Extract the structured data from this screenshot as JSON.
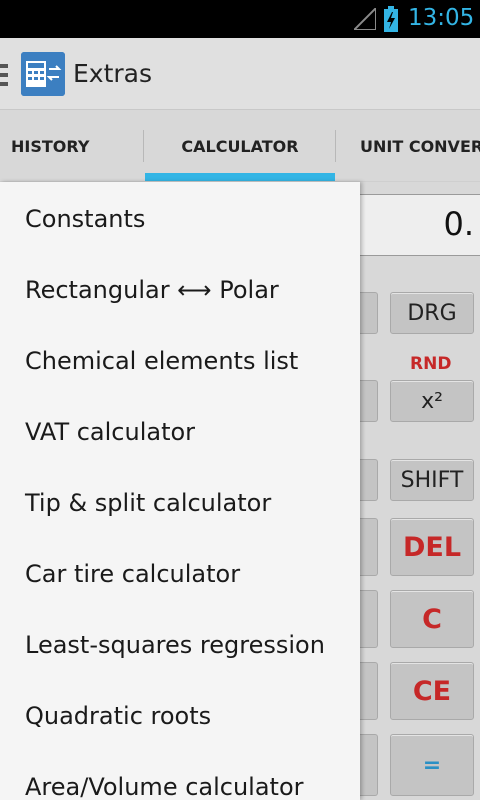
{
  "status_bar": {
    "time": "13:05",
    "icons": [
      "signal-icon",
      "battery-charging-icon"
    ],
    "accent_color": "#33b5e5"
  },
  "action_bar": {
    "title": "Extras",
    "icon": "calculator-convert-icon"
  },
  "tabs": [
    {
      "label": "HISTORY"
    },
    {
      "label": "CALCULATOR",
      "selected": true
    },
    {
      "label": "UNIT CONVERT"
    }
  ],
  "drawer": {
    "items": [
      {
        "label": "Constants"
      },
      {
        "label": "Rectangular ⟷ Polar"
      },
      {
        "label": "Chemical elements list"
      },
      {
        "label": "VAT calculator"
      },
      {
        "label": "Tip & split calculator"
      },
      {
        "label": "Car tire calculator"
      },
      {
        "label": "Least-squares regression"
      },
      {
        "label": "Quadratic roots"
      },
      {
        "label": "Area/Volume calculator"
      }
    ]
  },
  "calculator": {
    "display": "0.",
    "keys": {
      "drg": "DRG",
      "rnd": "RND",
      "square": "x²",
      "shift": "SHIFT",
      "del": "DEL",
      "clear": "C",
      "clear_entry": "CE",
      "equals": "="
    }
  }
}
